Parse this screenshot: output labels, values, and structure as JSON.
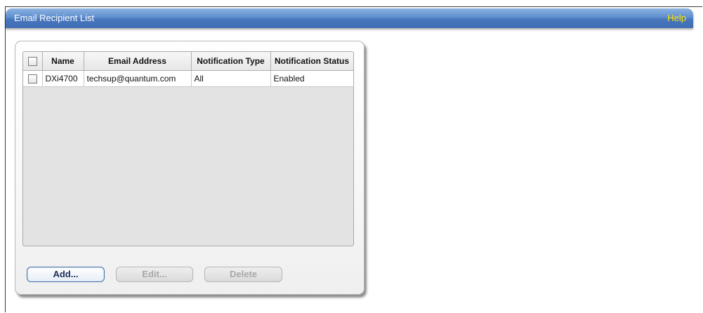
{
  "header": {
    "title": "Email Recipient List",
    "help_label": "Help"
  },
  "table": {
    "columns": [
      "Name",
      "Email Address",
      "Notification Type",
      "Notification Status"
    ],
    "rows": [
      {
        "name": "DXi4700",
        "email": "techsup@quantum.com",
        "notification_type": "All",
        "notification_status": "Enabled"
      }
    ]
  },
  "buttons": {
    "add_label": "Add...",
    "edit_label": "Edit...",
    "delete_label": "Delete"
  },
  "colors": {
    "title_bar": "#4977bd",
    "help_link": "#ffe600",
    "disabled_text": "#a8a8a8"
  }
}
